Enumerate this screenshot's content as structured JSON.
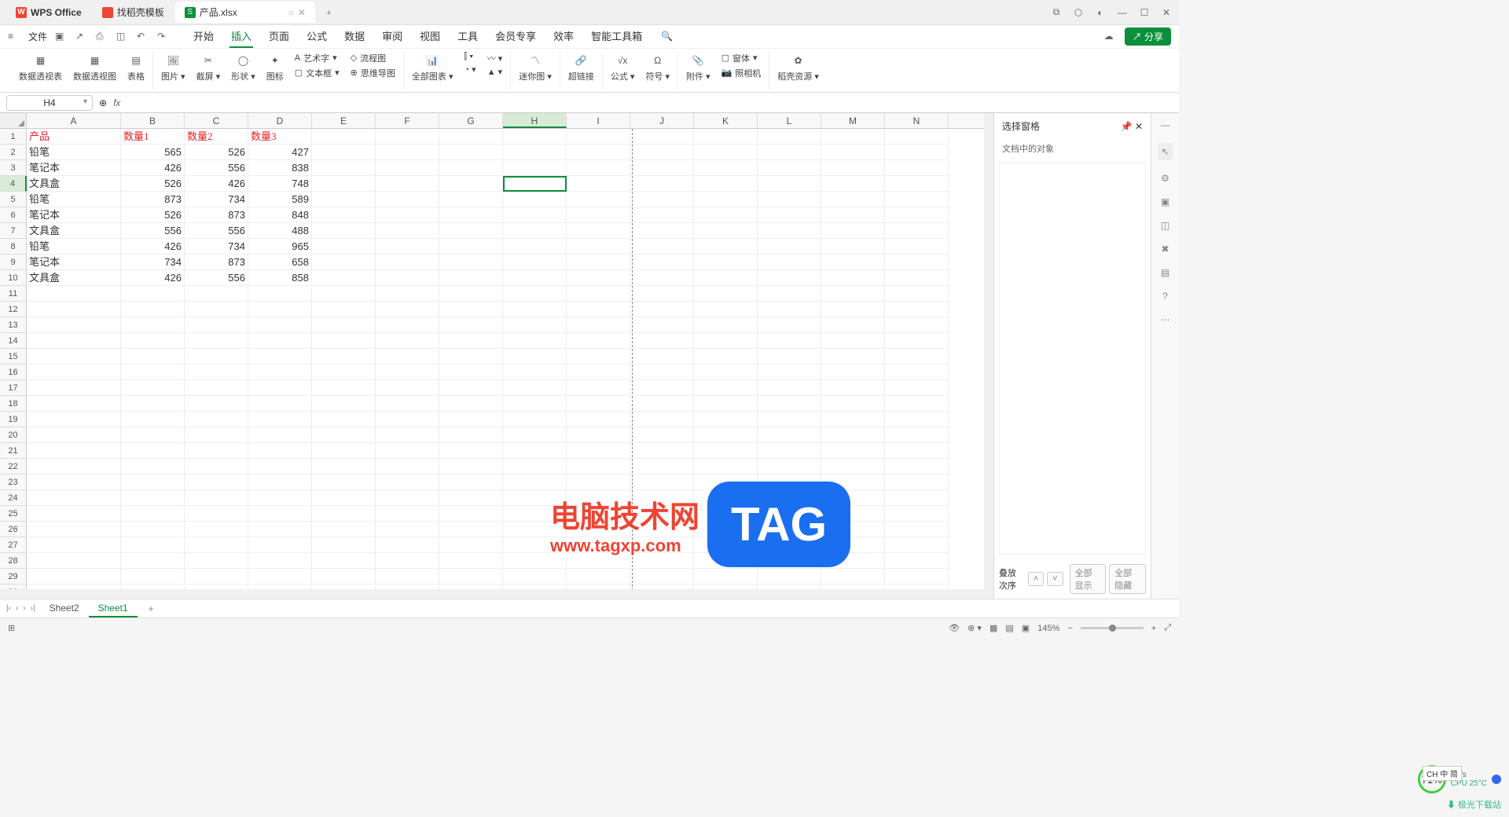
{
  "title_bar": {
    "app_name": "WPS Office",
    "template_tab": "找稻壳模板",
    "file_tab": "产品.xlsx",
    "file_prefix": "S"
  },
  "menu": {
    "file": "文件",
    "tabs": [
      "开始",
      "插入",
      "页面",
      "公式",
      "数据",
      "审阅",
      "视图",
      "工具",
      "会员专享",
      "效率",
      "智能工具箱"
    ],
    "active_index": 1,
    "share": "分享"
  },
  "ribbon": {
    "pivot_table": "数据透视表",
    "pivot_chart": "数据透视图",
    "table": "表格",
    "picture": "图片",
    "screenshot": "截屏",
    "shapes": "形状",
    "icons": "图标",
    "wordart": "艺术字",
    "textbox": "文本框",
    "flowchart": "流程图",
    "mindmap": "思维导图",
    "all_charts": "全部图表",
    "sparkline": "迷你图",
    "hyperlink": "超链接",
    "formula": "公式",
    "symbol": "符号",
    "attachment": "附件",
    "camera": "照相机",
    "object": "窗体",
    "resources": "稻壳资源"
  },
  "formula_bar": {
    "cell_ref": "H4",
    "fx": "fx"
  },
  "columns": [
    "A",
    "B",
    "C",
    "D",
    "E",
    "F",
    "G",
    "H",
    "I",
    "J",
    "K",
    "L",
    "M",
    "N"
  ],
  "selected_col": "H",
  "selected_row": 4,
  "data": {
    "headers": [
      "产品",
      "数量1",
      "数量2",
      "数量3"
    ],
    "rows": [
      [
        "铅笔",
        "565",
        "526",
        "427"
      ],
      [
        "笔记本",
        "426",
        "556",
        "838"
      ],
      [
        "文具盒",
        "526",
        "426",
        "748"
      ],
      [
        "铅笔",
        "873",
        "734",
        "589"
      ],
      [
        "笔记本",
        "526",
        "873",
        "848"
      ],
      [
        "文具盒",
        "556",
        "556",
        "488"
      ],
      [
        "铅笔",
        "426",
        "734",
        "965"
      ],
      [
        "笔记本",
        "734",
        "873",
        "658"
      ],
      [
        "文具盒",
        "426",
        "556",
        "858"
      ]
    ]
  },
  "row_count": 30,
  "right_panel": {
    "title": "选择窗格",
    "subtitle": "文档中的对象",
    "stack_order": "叠放次序",
    "show_all": "全部显示",
    "hide_all": "全部隐藏"
  },
  "sheets": {
    "items": [
      "Sheet2",
      "Sheet1"
    ],
    "active_index": 1
  },
  "status": {
    "zoom": "145%",
    "ime": "CH 中 简"
  },
  "watermark": {
    "line1": "电脑技术网",
    "line2": "www.tagxp.com",
    "tag": "TAG"
  },
  "perf": {
    "percent": "71%",
    "net": "0K/s",
    "cpu": "CPU 25°C"
  },
  "download_site": "极光下载站"
}
